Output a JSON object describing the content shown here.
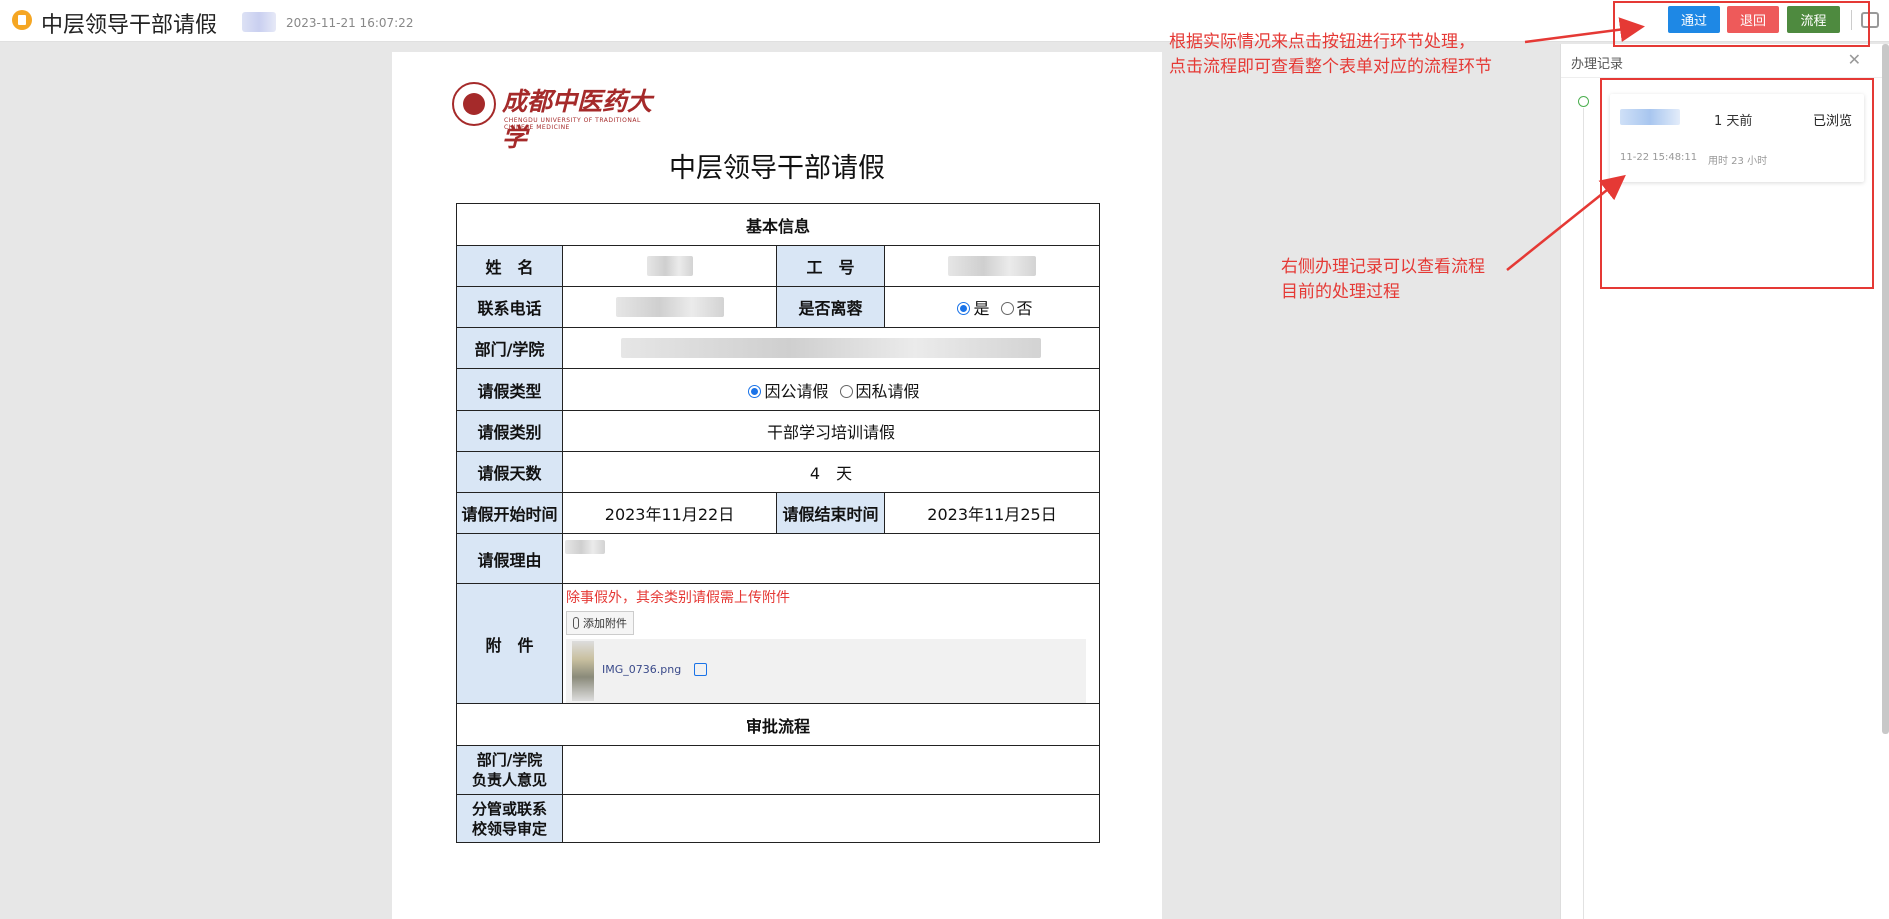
{
  "header": {
    "title": "中层领导干部请假",
    "timestamp": "2023-11-21 16:07:22",
    "buttons": {
      "pass": "通过",
      "return": "退回",
      "flow": "流程"
    }
  },
  "annotations": {
    "top_line1": "根据实际情况来点击按钮进行环节处理，",
    "top_line2": "点击流程即可查看整个表单对应的流程环节",
    "side_line1": "右侧办理记录可以查看流程",
    "side_line2": "目前的处理过程"
  },
  "document": {
    "logo_name": "成都中医药大学",
    "logo_sub": "CHENGDU UNIVERSITY OF TRADITIONAL CHINESE MEDICINE",
    "title": "中层领导干部请假",
    "basic_info_heading": "基本信息",
    "labels": {
      "name": "姓　名",
      "employee_id": "工　号",
      "phone": "联系电话",
      "leave_city": "是否离蓉",
      "department": "部门/学院",
      "leave_type": "请假类型",
      "leave_category": "请假类别",
      "leave_days": "请假天数",
      "start_time": "请假开始时间",
      "end_time": "请假结束时间",
      "reason": "请假理由",
      "attachment": "附　件"
    },
    "leave_city_options": {
      "yes": "是",
      "no": "否"
    },
    "leave_type_options": {
      "official": "因公请假",
      "private": "因私请假"
    },
    "leave_category_value": "干部学习培训请假",
    "leave_days_value": "4　天",
    "start_date": "2023年11月22日",
    "end_date": "2023年11月25日",
    "attachment_note": "除事假外，其余类别请假需上传附件",
    "add_attachment": "添加附件",
    "file_name": "IMG_0736.png",
    "approval_heading": "审批流程",
    "approval_dept_line1": "部门/学院",
    "approval_dept_line2": "负责人意见",
    "approval_leader_line1": "分管或联系",
    "approval_leader_line2": "校领导审定"
  },
  "panel": {
    "title": "办理记录",
    "record": {
      "ago": "1 天前",
      "status": "已浏览",
      "time": "11-22 15:48:11",
      "duration": "用时 23 小时"
    }
  }
}
